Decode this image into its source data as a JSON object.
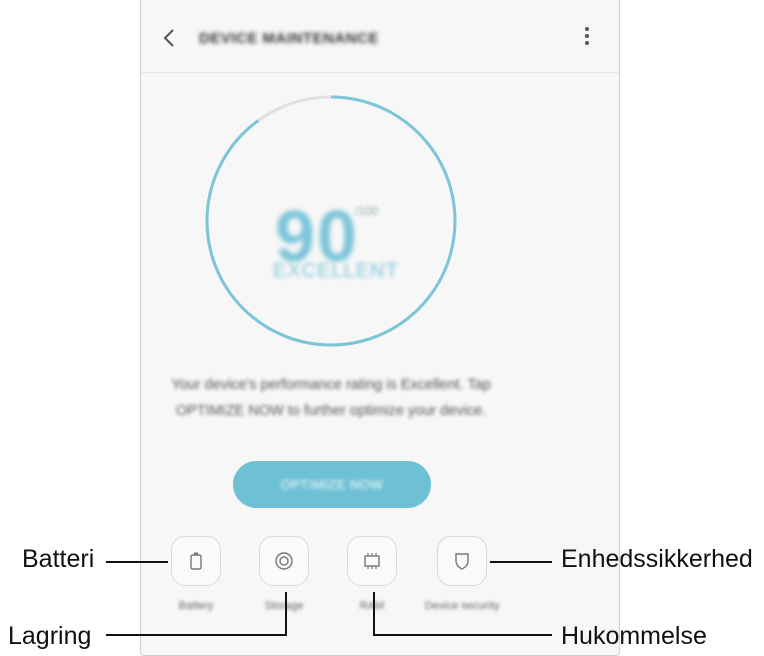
{
  "header": {
    "title": "DEVICE MAINTENANCE"
  },
  "gauge": {
    "score": "90",
    "score_unit": "/100",
    "status": "EXCELLENT",
    "fill_fraction": 0.9,
    "colors": {
      "arc": "#7cc5d9",
      "track": "#e0e0e0"
    }
  },
  "description": "Your device's performance rating is Excellent. Tap OPTIMIZE NOW to further optimize your device.",
  "optimize_button": {
    "label": "OPTIMIZE NOW",
    "color": "#6ec0d4"
  },
  "tools": [
    {
      "label": "Battery",
      "sub": "",
      "icon": "battery-icon"
    },
    {
      "label": "Storage",
      "sub": "",
      "icon": "storage-icon"
    },
    {
      "label": "RAM",
      "sub": "",
      "icon": "memory-chip-icon"
    },
    {
      "label": "Device security",
      "sub": "",
      "icon": "shield-icon"
    }
  ],
  "callouts": {
    "battery": "Batteri",
    "storage": "Lagring",
    "security": "Enhedssikkerhed",
    "memory": "Hukommelse"
  }
}
